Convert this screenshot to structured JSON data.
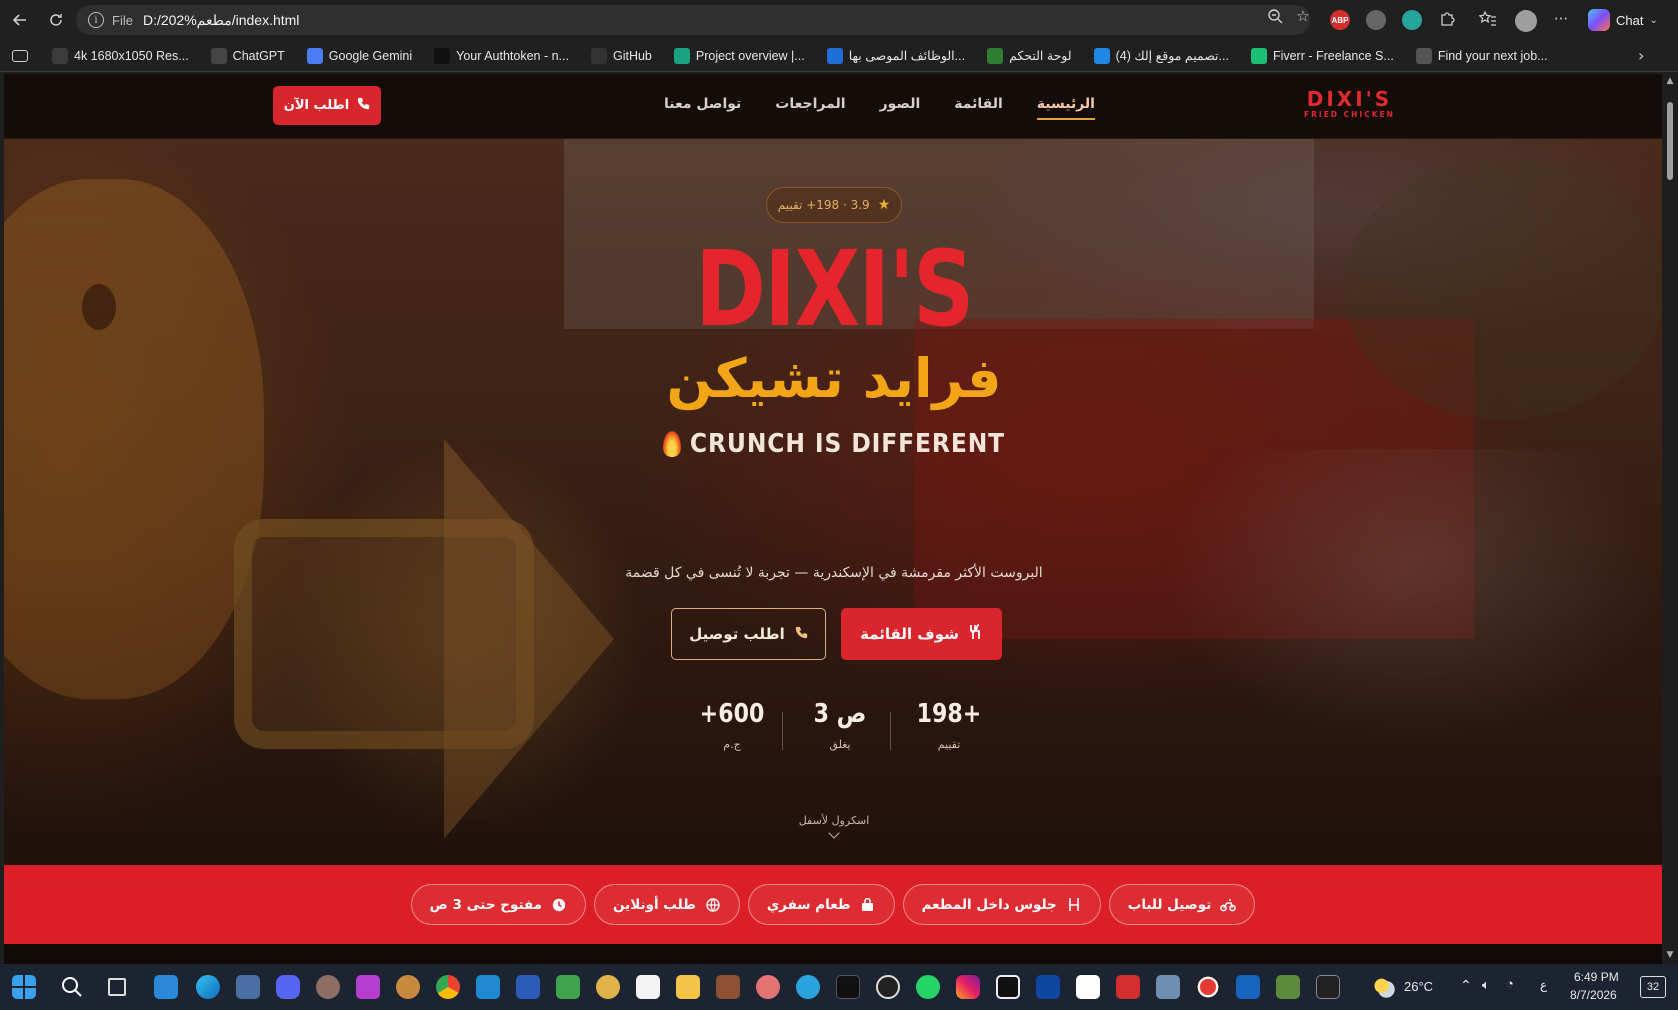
{
  "browser": {
    "url_scheme": "File",
    "url_path": "D:/202%مطعم/index.html",
    "chat_label": "Chat",
    "bookmarks": [
      {
        "label": "4k 1680x1050 Res...",
        "icon": "monitor-icon",
        "color": "#3b3b3b"
      },
      {
        "label": "ChatGPT",
        "icon": "chatgpt-icon",
        "color": "#444"
      },
      {
        "label": "Google Gemini",
        "icon": "gemini-icon",
        "color": "#4a7bf0"
      },
      {
        "label": "Your Authtoken - n...",
        "icon": "ngrok-icon",
        "color": "#111"
      },
      {
        "label": "GitHub",
        "icon": "github-icon",
        "color": "#333"
      },
      {
        "label": "Project overview |...",
        "icon": "project-icon",
        "color": "#1ba37f"
      },
      {
        "label": "الوظائف الموصى بها...",
        "icon": "jobs-icon",
        "color": "#1f6fd6"
      },
      {
        "label": "لوحة التحكم",
        "icon": "dashboard-icon",
        "color": "#2e7d32"
      },
      {
        "label": "(4) تصميم موقع إلك...",
        "icon": "design-icon",
        "color": "#1e88e5"
      },
      {
        "label": "Fiverr - Freelance S...",
        "icon": "fiverr-icon",
        "color": "#1dbf73"
      },
      {
        "label": "Find your next job...",
        "icon": "job-icon",
        "color": "#555"
      }
    ]
  },
  "site": {
    "logo_main": "DIXI'S",
    "logo_sub": "FRIED CHICKEN",
    "nav": [
      {
        "label": "الرئيسية",
        "active": true
      },
      {
        "label": "القائمة",
        "active": false
      },
      {
        "label": "الصور",
        "active": false
      },
      {
        "label": "المراجعات",
        "active": false
      },
      {
        "label": "تواصل معنا",
        "active": false
      }
    ],
    "order_now": "اطلب الآن",
    "accent": "#d9262c",
    "gold": "#f2a516"
  },
  "hero": {
    "rating_pill": "3.9 · 198+ تقييم",
    "title": "DIXI'S",
    "subtitle_ar": "فرايد تشيكن",
    "tagline": "CRUNCH IS DIFFERENT",
    "description": "البروست الأكثر مقرمشة في الإسكندرية — تجربة لا تُنسى في كل قضمة",
    "btn_menu": "شوف القائمة",
    "btn_delivery": "اطلب توصيل",
    "stats": [
      {
        "value": "198+",
        "label": "تقييم"
      },
      {
        "value": "3 ص",
        "label": "يغلق"
      },
      {
        "value": "+600",
        "label": "ج.م"
      }
    ],
    "scroll_hint": "اسكرول لأسفل"
  },
  "features": [
    {
      "label": "توصيل للباب",
      "icon": "motorbike-icon"
    },
    {
      "label": "جلوس داخل المطعم",
      "icon": "chair-icon"
    },
    {
      "label": "طعام سفري",
      "icon": "bag-icon"
    },
    {
      "label": "طلب أونلاين",
      "icon": "globe-icon"
    },
    {
      "label": "مفتوح حتى 3 ص",
      "icon": "clock-icon"
    }
  ],
  "taskbar": {
    "weather": "26°C",
    "lang": "ع",
    "time": "6:49 PM",
    "date": "8/7/2026",
    "notif_count": "32"
  }
}
